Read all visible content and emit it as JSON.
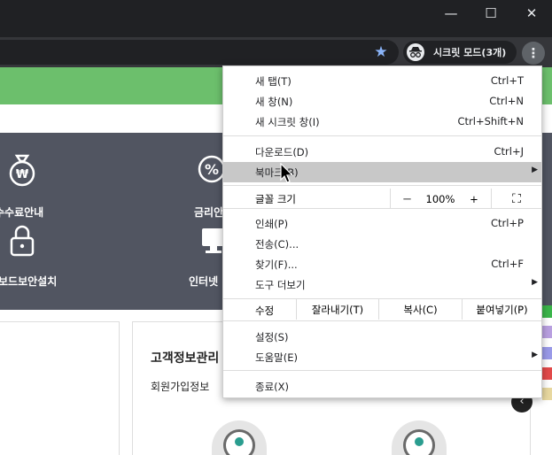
{
  "window": {
    "minimize_icon": "minimize-icon",
    "maximize_icon": "maximize-icon",
    "close_icon": "close-icon",
    "min_glyph": "—",
    "max_glyph": "☐",
    "close_glyph": "✕"
  },
  "toolbar": {
    "incognito_label": "시크릿 모드(3개)",
    "star_glyph": "★",
    "menu_glyph": "⋮"
  },
  "page": {
    "services": [
      {
        "label": "수수료안내",
        "icon": "won-bag-icon"
      },
      {
        "label": "금리안",
        "icon": "percent-icon"
      },
      {
        "label": "보드보안설치",
        "icon": "lock-icon"
      },
      {
        "label": "인터넷",
        "icon": "monitor-icon"
      }
    ],
    "card_title": "고객정보관리",
    "card_subtitle": "회원가입정보 "
  },
  "menu": {
    "new_tab": {
      "label": "새 탭(T)",
      "shortcut": "Ctrl+T"
    },
    "new_window": {
      "label": "새 창(N)",
      "shortcut": "Ctrl+N"
    },
    "new_incognito": {
      "label": "새 시크릿 창(I)",
      "shortcut": "Ctrl+Shift+N"
    },
    "downloads": {
      "label": "다운로드(D)",
      "shortcut": "Ctrl+J"
    },
    "bookmarks": {
      "label": "북마크(B)"
    },
    "zoom": {
      "label": "글꼴 크기",
      "minus": "－",
      "value": "100%",
      "plus": "+",
      "fullscreen": "⛶"
    },
    "print": {
      "label": "인쇄(P)",
      "shortcut": "Ctrl+P"
    },
    "cast": {
      "label": "전송(C)..."
    },
    "find": {
      "label": "찾기(F)...",
      "shortcut": "Ctrl+F"
    },
    "more_tools": {
      "label": "도구 더보기"
    },
    "edit": {
      "label": "수정",
      "cut": "잘라내기(T)",
      "copy": "복사(C)",
      "paste": "붙여넣기(P)"
    },
    "settings": {
      "label": "설정(S)"
    },
    "help": {
      "label": "도움말(E)"
    },
    "exit": {
      "label": "종료(X)"
    }
  }
}
